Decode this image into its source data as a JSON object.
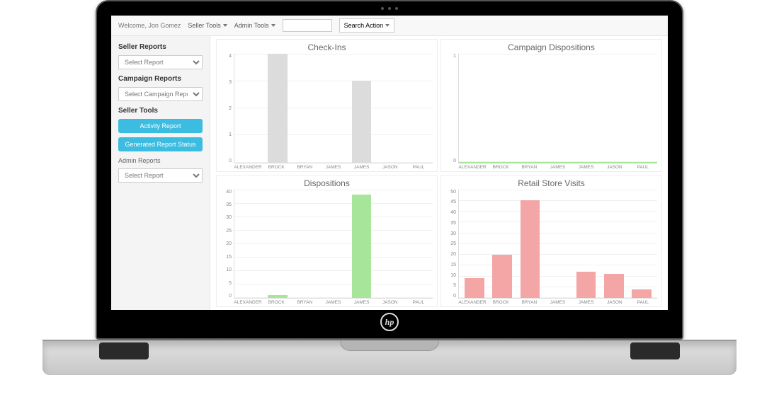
{
  "navbar": {
    "greet": "Welcome, Jon Gomez",
    "seller_tools": "Seller Tools",
    "admin_tools": "Admin Tools",
    "search_placeholder": "",
    "search_action": "Search Action"
  },
  "sidebar": {
    "seller_reports_h": "Seller Reports",
    "seller_reports_sel": "Select Report",
    "campaign_reports_h": "Campaign Reports",
    "campaign_reports_sel": "Select Campaign Report",
    "seller_tools_h": "Seller Tools",
    "activity_btn": "Activity Report",
    "generated_btn": "Generated Report Status",
    "admin_reports_h": "Admin Reports",
    "admin_reports_sel": "Select Report"
  },
  "chart_data": [
    {
      "id": "checkins",
      "type": "bar",
      "title": "Check-Ins",
      "categories": [
        "ALEXANDER",
        "BROCK",
        "BRYAN",
        "JAMES",
        "JAMES",
        "JASON",
        "PAUL"
      ],
      "values": [
        0,
        4,
        0,
        0,
        3,
        0,
        0
      ],
      "ylim": [
        0,
        4
      ],
      "yticks": [
        0,
        1,
        2,
        3,
        4
      ],
      "bar_color": "#dcdcdc"
    },
    {
      "id": "campaign_dispositions",
      "type": "bar",
      "title": "Campaign Dispositions",
      "categories": [
        "ALEXANDER",
        "BROCK",
        "BRYAN",
        "JAMES",
        "JAMES",
        "JASON",
        "PAUL"
      ],
      "values": [
        0,
        0,
        0,
        0,
        0,
        0,
        0
      ],
      "ylim": [
        0,
        1
      ],
      "yticks": [
        0,
        1
      ],
      "bar_color": "#a7e59b",
      "baseline_color": "#a7e59b"
    },
    {
      "id": "dispositions",
      "type": "bar",
      "title": "Dispositions",
      "categories": [
        "ALEXANDER",
        "BROCK",
        "BRYAN",
        "JAMES",
        "JAMES",
        "JASON",
        "PAUL"
      ],
      "values": [
        0,
        1,
        0,
        0,
        38,
        0,
        0
      ],
      "ylim": [
        0,
        40
      ],
      "yticks": [
        0,
        5,
        10,
        15,
        20,
        25,
        30,
        35,
        40
      ],
      "bar_color": "#a7e59b"
    },
    {
      "id": "retail_visits",
      "type": "bar",
      "title": "Retail Store Visits",
      "categories": [
        "ALEXANDER",
        "BROCK",
        "BRYAN",
        "JAMES",
        "JAMES",
        "JASON",
        "PAUL"
      ],
      "values": [
        9,
        20,
        45,
        0,
        12,
        11,
        4
      ],
      "ylim": [
        0,
        50
      ],
      "yticks": [
        0,
        5,
        10,
        15,
        20,
        25,
        30,
        35,
        40,
        45,
        50
      ],
      "bar_color": "#f4a5a5"
    }
  ]
}
